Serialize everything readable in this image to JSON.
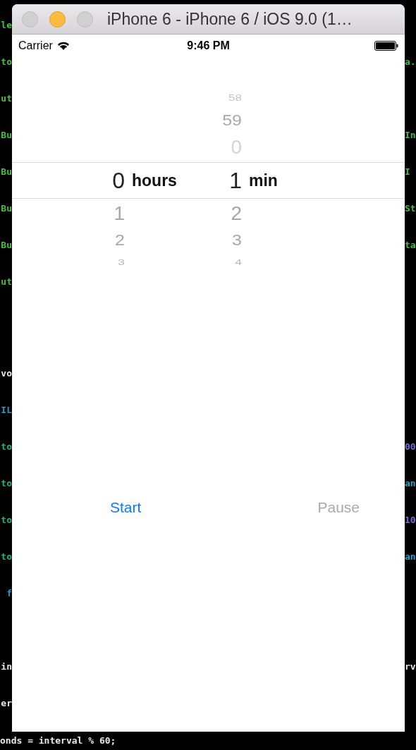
{
  "window": {
    "title": "iPhone 6 - iPhone 6 / iOS 9.0 (1…",
    "controls": [
      {
        "enabled": false
      },
      {
        "enabled": true
      },
      {
        "enabled": false
      }
    ]
  },
  "status_bar": {
    "carrier": "Carrier",
    "time": "9:46 PM"
  },
  "picker": {
    "columns": [
      {
        "unit": "hours",
        "items": [
          {
            "text": "0",
            "selected": true
          },
          {
            "text": "1",
            "selected": false
          },
          {
            "text": "2",
            "selected": false
          },
          {
            "text": "3",
            "selected": false
          }
        ]
      },
      {
        "unit": "min",
        "items": [
          {
            "text": "58",
            "selected": false
          },
          {
            "text": "59",
            "selected": false
          },
          {
            "text": "0",
            "selected": false
          },
          {
            "text": "1",
            "selected": true
          },
          {
            "text": "2",
            "selected": false
          },
          {
            "text": "3",
            "selected": false
          },
          {
            "text": "4",
            "selected": false
          }
        ]
      }
    ]
  },
  "buttons": [
    {
      "label": "Start",
      "disabled": false
    },
    {
      "label": "Pause",
      "disabled": true
    }
  ],
  "editor": {
    "left": [
      {
        "text": "le",
        "color": "#3ec23e"
      },
      {
        "text": "to",
        "color": "#3ec23e"
      },
      {
        "text": "ut",
        "color": "#3ec23e"
      },
      {
        "text": "Bu",
        "color": "#3ec23e"
      },
      {
        "text": "Bu",
        "color": "#3ec23e"
      },
      {
        "text": "Bu",
        "color": "#3ec23e"
      },
      {
        "text": "Bu",
        "color": "#3ec23e"
      },
      {
        "text": "ut",
        "color": "#3ec23e"
      },
      {
        "text": "vo",
        "color": "#e8e8e8"
      },
      {
        "text": "IL",
        "color": "#1a9ad6"
      },
      {
        "text": "to",
        "color": "#14b87a"
      },
      {
        "text": "to",
        "color": "#14b87a"
      },
      {
        "text": "to",
        "color": "#14b87a"
      },
      {
        "text": "to",
        "color": "#14b87a"
      },
      {
        "text": "f",
        "color": "#1a9ad6"
      },
      {
        "text": "in",
        "color": "#e8e8e8"
      },
      {
        "text": "er",
        "color": "#e8e8e8"
      }
    ],
    "right": [
      {
        "text": "a.",
        "color": "#3ec23e"
      },
      {
        "text": "In",
        "color": "#3ec23e"
      },
      {
        "text": "I",
        "color": "#3ec23e"
      },
      {
        "text": "St",
        "color": "#3ec23e"
      },
      {
        "text": "ta",
        "color": "#3ec23e"
      },
      {
        "text": "00",
        "color": "#7a6ae0"
      },
      {
        "text": "an",
        "color": "#1fa5c9"
      },
      {
        "text": "10",
        "color": "#7a6ae0"
      },
      {
        "text": "an",
        "color": "#1fa5c9"
      },
      {
        "text": "rv",
        "color": "#e8e8e8"
      }
    ],
    "bottom_line": {
      "text": "onds = interval % 60;",
      "color": "#e8e8e8"
    }
  }
}
